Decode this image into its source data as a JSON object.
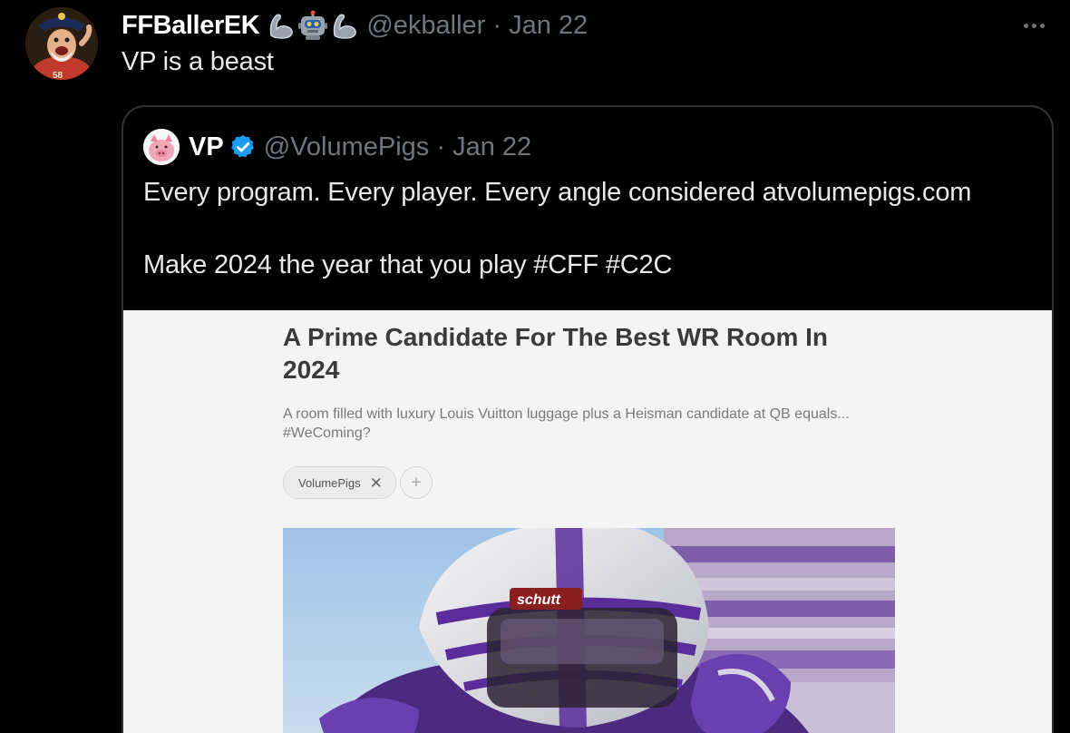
{
  "author": {
    "display_name": "FFBallerEK",
    "handle": "@ekballer",
    "date": "Jan 22",
    "name_emojis": [
      "flexed-biceps-icon",
      "robot-icon",
      "flexed-biceps-icon"
    ]
  },
  "tweet": {
    "text": "VP is a beast"
  },
  "quoted": {
    "display_name": "VP",
    "verified": true,
    "handle": "@VolumePigs",
    "date": "Jan 22",
    "paragraphs": [
      "Every program. Every player. Every angle considered atvolumepigs.com",
      "Make 2024 the year that you play #CFF #C2C"
    ],
    "media": {
      "title": "A Prime Candidate For The Best WR Room In 2024",
      "description": "A room filled with luxury Louis Vuitton luggage plus a Heisman candidate at QB equals... #WeComing?",
      "tag": "VolumePigs",
      "tag_remove_symbol": "✕",
      "add_symbol": "+",
      "helmet_brand": "schutt"
    }
  },
  "colors": {
    "background": "#000000",
    "text": "#e7e9ea",
    "secondary": "#71767b",
    "border": "#2f3336",
    "verified": "#1d9bf0",
    "accent_purple": "#5a2d9a"
  },
  "separator": " · "
}
